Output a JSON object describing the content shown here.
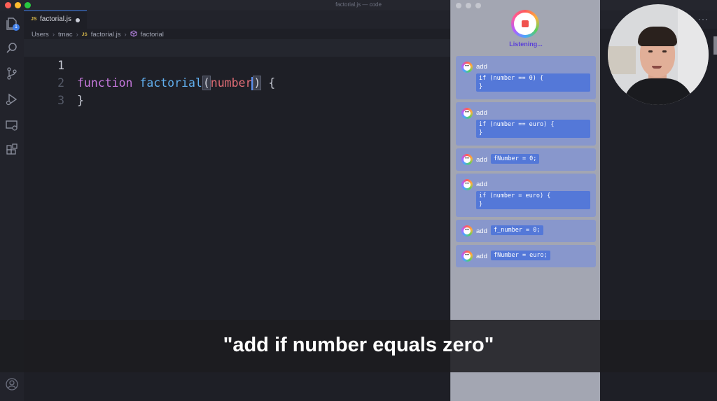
{
  "window": {
    "title": "factorial.js — code"
  },
  "activity_bar": {
    "explorer_badge": "1",
    "icons": [
      "files-icon",
      "search-icon",
      "source-control-icon",
      "run-debug-icon",
      "remote-explorer-icon",
      "extensions-icon",
      "account-icon"
    ]
  },
  "tab": {
    "file_type": "JS",
    "name": "factorial.js"
  },
  "breadcrumb": {
    "segments": [
      "Users",
      "tmac",
      "factorial.js",
      "factorial"
    ],
    "file_type": "JS"
  },
  "editor": {
    "line_numbers": [
      "1",
      "2",
      "3"
    ],
    "line1": {
      "keyword": "function",
      "fn_name": "factorial",
      "open_paren": "(",
      "param": "number",
      "close_paren": ")",
      "brace": "{"
    },
    "line2": {
      "brace": "}"
    }
  },
  "voice_panel": {
    "status": "Listening...",
    "commands": [
      {
        "action": "add",
        "code": "if (number == 0) {\n}"
      },
      {
        "action": "add",
        "code": "if (number == euro) {\n}"
      },
      {
        "action": "add",
        "code": "fNumber = 0;"
      },
      {
        "action": "add",
        "code": "if (number = euro) {\n}"
      },
      {
        "action": "add",
        "code": "f_number = 0;"
      },
      {
        "action": "add",
        "code": "fNumber = euro;"
      }
    ]
  },
  "caption": {
    "text": "\"add if number equals zero\""
  },
  "tabbar_more": "···",
  "colors": {
    "accent": "#3f7ee8",
    "keyword": "#c678dd",
    "function": "#61afef",
    "param": "#e06c75",
    "listening": "#5a40d8",
    "code_box": "#5478d8"
  }
}
